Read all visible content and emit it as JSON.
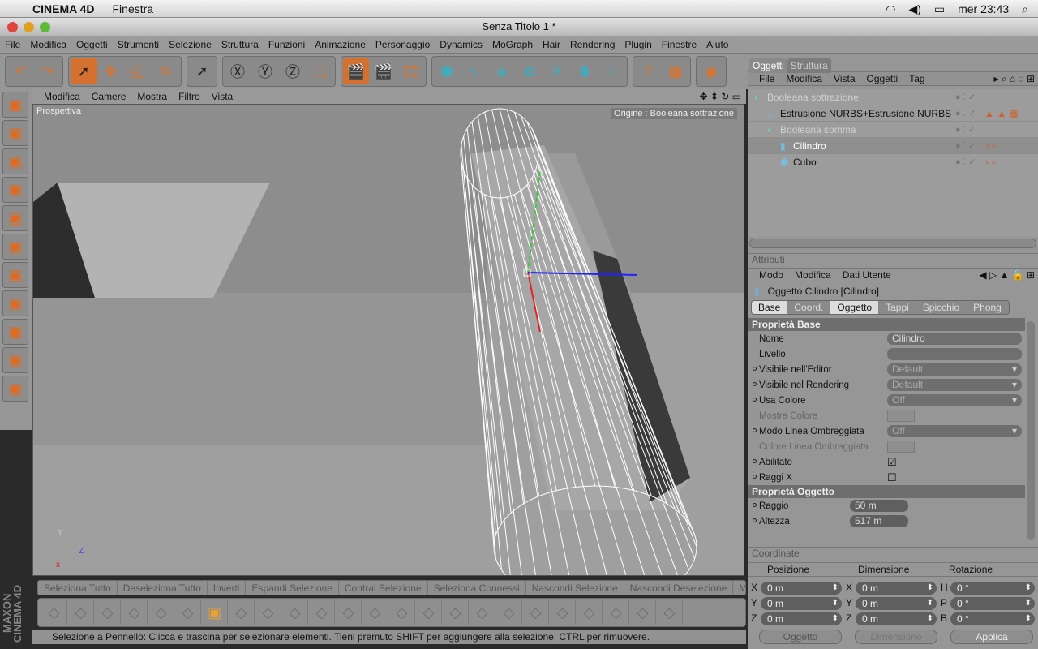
{
  "mac": {
    "app": "CINEMA 4D",
    "menu": "Finestra",
    "clock": "mer 23:43"
  },
  "window": {
    "title": "Senza Titolo 1 *"
  },
  "menu": [
    "File",
    "Modifica",
    "Oggetti",
    "Strumenti",
    "Selezione",
    "Struttura",
    "Funzioni",
    "Animazione",
    "Personaggio",
    "Dynamics",
    "MoGraph",
    "Hair",
    "Rendering",
    "Plugin",
    "Finestre",
    "Aiuto"
  ],
  "toolbar": [
    [
      "undo-icon",
      "redo-icon"
    ],
    [
      "select-icon",
      "move-icon",
      "scale-icon",
      "rotate-icon"
    ],
    [
      "live-select-icon"
    ],
    [
      "x-axis-icon",
      "y-axis-icon",
      "z-axis-icon",
      "coordinate-system-icon"
    ],
    [
      "render-view-icon",
      "render-picture-icon",
      "render-settings-icon"
    ],
    [
      "cube-icon",
      "spline-icon",
      "nurbs-icon",
      "array-icon",
      "deformer-icon",
      "scene-icon",
      "particle-icon"
    ],
    [
      "help-icon",
      "layout-icon"
    ],
    [
      "globe-icon"
    ]
  ],
  "left_toolbar": [
    "model-mode-icon",
    "object-mode-icon",
    "axis-icon",
    "animation-icon",
    "points-icon",
    "edges-icon",
    "polygons-icon",
    "uvw-icon",
    "texture-icon",
    "texture-axis-icon",
    "sculpt-icon"
  ],
  "viewport": {
    "menu": [
      "Modifica",
      "Camere",
      "Mostra",
      "Filtro",
      "Vista"
    ],
    "label": "Prospettiva",
    "origin": "Origine : Booleana sottrazione"
  },
  "logo": "MAXON CINEMA 4D",
  "selection_commands": [
    "Seleziona Tutto",
    "Deseleziona Tutto",
    "Inverti",
    "Espandi Selezione",
    "Contrai Selezione",
    "Seleziona Connessi",
    "Nascondi Selezione",
    "Nascondi Deselezione",
    "Mo"
  ],
  "bottom_icons": [
    "brush-select-icon",
    "grid-add-icon",
    "extrude-icon",
    "bridge-icon",
    "knife-icon",
    "bevel-icon",
    "live-selection-add-icon",
    "loop-icon",
    "extrude-inner-icon",
    "smooth-shift-icon",
    "matrix-extrude-icon",
    "slice-icon",
    "magnet-icon",
    "polygon-pen-icon",
    "mirror-icon",
    "move-along-normals-icon",
    "scale-along-normals-icon",
    "rotate-normals-icon",
    "weld-icon",
    "split-icon",
    "stitch-icon",
    "melt-icon",
    "iron-icon",
    "brush-icon"
  ],
  "status": "Selezione a Pennello: Clicca e trascina per selezionare elementi. Tieni premuto SHIFT per aggiungere alla selezione, CTRL per rimuovere.",
  "objects": {
    "tabs": [
      "Oggetti",
      "Struttura"
    ],
    "menu": [
      "File",
      "Modifica",
      "Vista",
      "Oggetti",
      "Tag"
    ],
    "tree": [
      {
        "name": "Booleana sottrazione",
        "indent": 0,
        "dim": true,
        "icon": "boolean-icon",
        "tags": ""
      },
      {
        "name": "Estrusione NURBS+Estrusione NURBS",
        "indent": 1,
        "dim": false,
        "icon": "polygon-object-icon",
        "tags": "▲ ▲ ▦"
      },
      {
        "name": "Booleana somma",
        "indent": 1,
        "dim": true,
        "icon": "boolean-icon",
        "tags": ""
      },
      {
        "name": "Cilindro",
        "indent": 2,
        "dim": false,
        "icon": "cylinder-icon",
        "tags": "∘∘",
        "selected": true
      },
      {
        "name": "Cubo",
        "indent": 2,
        "dim": false,
        "icon": "cube-icon",
        "tags": "∘∘"
      }
    ]
  },
  "attributes": {
    "title": "Attributi",
    "menu": [
      "Modo",
      "Modifica",
      "Dati Utente"
    ],
    "object": "Oggetto Cilindro [Cilindro]",
    "tabs": [
      "Base",
      "Coord.",
      "Oggetto",
      "Tappi",
      "Spicchio",
      "Phong"
    ],
    "active_tabs": [
      "Base",
      "Oggetto"
    ],
    "section_base": "Proprietà Base",
    "props": [
      {
        "label": "Nome",
        "value": "Cilindro",
        "type": "text",
        "dot": false
      },
      {
        "label": "Livello",
        "value": "",
        "type": "link",
        "dot": false
      },
      {
        "label": "Visibile nell'Editor",
        "value": "Default",
        "type": "dropdown",
        "dot": true
      },
      {
        "label": "Visibile nel Rendering",
        "value": "Default",
        "type": "dropdown",
        "dot": true
      },
      {
        "label": "Usa Colore",
        "value": "Off",
        "type": "dropdown",
        "dot": true
      },
      {
        "label": "Mostra Colore",
        "value": "",
        "type": "color",
        "dot": false,
        "disabled": true
      },
      {
        "label": "Modo Linea Ombreggiata",
        "value": "Off",
        "type": "dropdown",
        "dot": true
      },
      {
        "label": "Colore Linea Ombreggiata",
        "value": "",
        "type": "color",
        "dot": false,
        "disabled": true
      },
      {
        "label": "Abilitato",
        "value": true,
        "type": "checkbox",
        "dot": true
      },
      {
        "label": "Raggi X",
        "value": false,
        "type": "checkbox",
        "dot": true
      }
    ],
    "section_object": "Proprietà Oggetto",
    "object_props": [
      {
        "label": "Raggio",
        "value": "50 m"
      },
      {
        "label": "Altezza",
        "value": "517 m"
      }
    ]
  },
  "coordinates": {
    "title": "Coordinate",
    "headers": [
      "Posizione",
      "Dimensione",
      "Rotazione"
    ],
    "rows": [
      {
        "p": "X",
        "pv": "0 m",
        "d": "X",
        "dv": "0 m",
        "r": "H",
        "rv": "0 °"
      },
      {
        "p": "Y",
        "pv": "0 m",
        "d": "Y",
        "dv": "0 m",
        "r": "P",
        "rv": "0 °"
      },
      {
        "p": "Z",
        "pv": "0 m",
        "d": "Z",
        "dv": "0 m",
        "r": "B",
        "rv": "0 °"
      }
    ],
    "mode": "Oggetto",
    "size_mode": "Dimensione",
    "apply": "Applica"
  }
}
